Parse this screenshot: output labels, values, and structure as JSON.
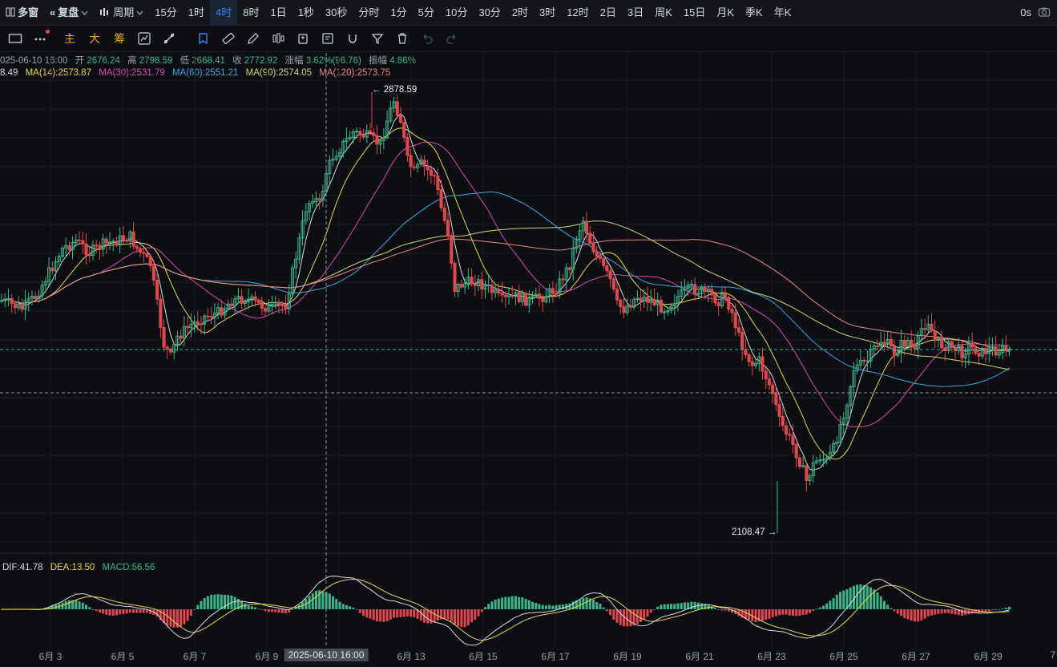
{
  "topbar": {
    "items": [
      {
        "label": "多窗",
        "name": "multi-window-button",
        "bold": true
      },
      {
        "label": "复盘",
        "name": "replay-button",
        "bold": true
      },
      {
        "label": "周期",
        "name": "period-dropdown",
        "bold": false
      },
      {
        "label": "15分",
        "name": "period-15m"
      },
      {
        "label": "1时",
        "name": "period-1h"
      },
      {
        "label": "4时",
        "name": "period-4h",
        "active": true
      },
      {
        "label": "8时",
        "name": "period-8h"
      },
      {
        "label": "1日",
        "name": "period-1d"
      },
      {
        "label": "1秒",
        "name": "period-1s"
      },
      {
        "label": "30秒",
        "name": "period-30s"
      },
      {
        "label": "分时",
        "name": "period-timeshare"
      },
      {
        "label": "1分",
        "name": "period-1m"
      },
      {
        "label": "5分",
        "name": "period-5m"
      },
      {
        "label": "10分",
        "name": "period-10m"
      },
      {
        "label": "30分",
        "name": "period-30m"
      },
      {
        "label": "2时",
        "name": "period-2h"
      },
      {
        "label": "3时",
        "name": "period-3h"
      },
      {
        "label": "12时",
        "name": "period-12h"
      },
      {
        "label": "2日",
        "name": "period-2d"
      },
      {
        "label": "3日",
        "name": "period-3d"
      },
      {
        "label": "周K",
        "name": "period-week"
      },
      {
        "label": "15日",
        "name": "period-15d"
      },
      {
        "label": "月K",
        "name": "period-month"
      },
      {
        "label": "季K",
        "name": "period-quarter"
      },
      {
        "label": "年K",
        "name": "period-year"
      }
    ],
    "latency": "0s"
  },
  "toolbar": {
    "text_tools": [
      "主",
      "大",
      "筹"
    ]
  },
  "ohlc": {
    "date": "025-06-10 16:00",
    "open_label": "开",
    "open": "2676.24",
    "high_label": "高",
    "high": "2798.59",
    "low_label": "低",
    "low": "2668.41",
    "close_label": "收",
    "close": "2772.92",
    "change_label": "涨幅",
    "change": "3.62%(96.76)",
    "amp_label": "振幅",
    "amp": "4.86%"
  },
  "ma": {
    "first": "8.49",
    "ma14": "MA(14):2573.87",
    "ma30": "MA(30):2531.79",
    "ma60": "MA(60):2551.21",
    "ma90": "MA(90):2574.05",
    "ma120": "MA(120):2573.75"
  },
  "macd": {
    "dif": "DIF:41.78",
    "dea": "DEA:13.50",
    "macd": "MACD:56.56"
  },
  "price_labels": {
    "high": "2878.59",
    "low": "2108.47"
  },
  "xaxis": {
    "labels": [
      "6月 3",
      "6月 5",
      "6月 7",
      "6月 9",
      "6月 13",
      "6月 15",
      "6月 17",
      "6月 19",
      "6月 21",
      "6月 23",
      "6月 25",
      "6月 27",
      "6月 29",
      "7"
    ],
    "crosshair": "2025-06-10 16:00"
  },
  "colors": {
    "up": "#39b78a",
    "down": "#e0474f",
    "ma14": "#e6d84a",
    "ma30": "#d64bb4",
    "ma60": "#3aa6e0",
    "ma90": "#c9d97a",
    "ma120": "#e58a8a",
    "accent": "#2f8cf0"
  },
  "chart_data": {
    "type": "candlestick",
    "interval": "4h",
    "series": [
      {
        "name": "MA(14)",
        "last": 2573.87
      },
      {
        "name": "MA(30)",
        "last": 2531.79
      },
      {
        "name": "MA(60)",
        "last": 2551.21
      },
      {
        "name": "MA(90)",
        "last": 2574.05
      },
      {
        "name": "MA(120)",
        "last": 2573.75
      }
    ],
    "period_high": 2878.59,
    "period_low": 2108.47,
    "selected_candle": {
      "time": "2025-06-10 16:00",
      "open": 2676.24,
      "high": 2798.59,
      "low": 2668.41,
      "close": 2772.92
    },
    "macd": {
      "DIF": 41.78,
      "DEA": 13.5,
      "MACD": 56.56
    }
  }
}
